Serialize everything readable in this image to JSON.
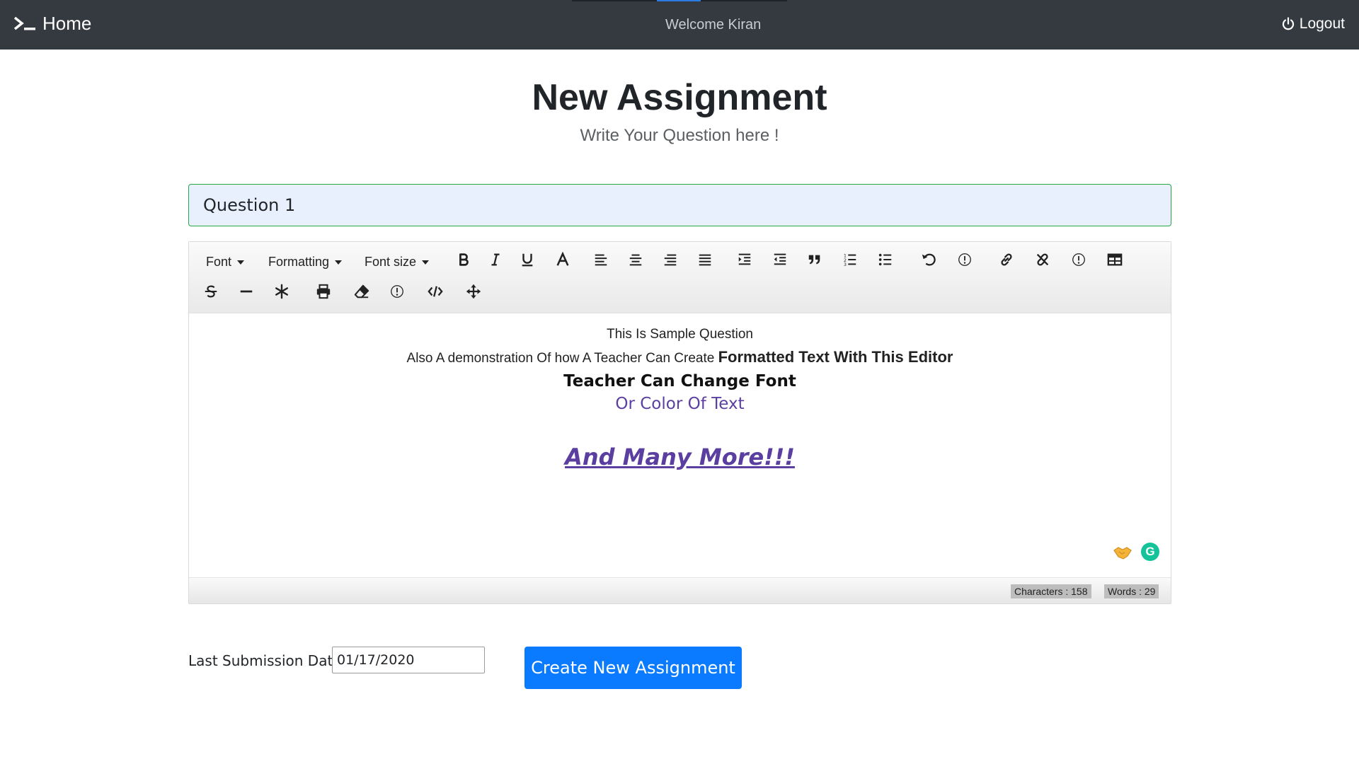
{
  "navbar": {
    "brand": "Home",
    "welcome": "Welcome Kiran",
    "logout": "Logout"
  },
  "header": {
    "title": "New Assignment",
    "subtitle": "Write Your Question here !"
  },
  "question": {
    "title_value": "Question 1"
  },
  "editor": {
    "toolbar": {
      "font_label": "Font",
      "formatting_label": "Formatting",
      "font_size_label": "Font size",
      "buttons_row1": [
        "bold-icon",
        "italic-icon",
        "underline-icon",
        "font-color-icon",
        "align-left-icon",
        "align-center-icon",
        "align-right-icon",
        "align-justify-icon",
        "indent-icon",
        "outdent-icon",
        "blockquote-icon",
        "ordered-list-icon",
        "unordered-list-icon",
        "undo-icon",
        "info-icon",
        "link-icon",
        "unlink-icon",
        "info-icon",
        "table-icon"
      ],
      "buttons_row2": [
        "strikethrough-icon",
        "horizontal-rule-icon",
        "special-char-icon",
        "print-icon",
        "eraser-icon",
        "info-icon",
        "code-icon",
        "move-icon"
      ]
    },
    "content": {
      "line1": "This Is Sample Question",
      "line2_plain": "Also A demonstration Of how A Teacher Can Create ",
      "line2_bold": "Formatted Text With This Editor",
      "line3": "Teacher Can Change Font",
      "line4": "Or Color Of Text",
      "line5": "And Many More!!!"
    },
    "status": {
      "characters": "Characters : 158",
      "words": "Words : 29"
    },
    "accent_color": "#5b3fa0"
  },
  "form": {
    "date_label": "Last Submission Date :",
    "date_value": "01/17/2020",
    "create_button": "Create New Assignment"
  },
  "colors": {
    "navbar_bg": "#343a40",
    "primary": "#0a7bff",
    "input_border": "#28a745",
    "input_bg": "#e8f0fe"
  }
}
